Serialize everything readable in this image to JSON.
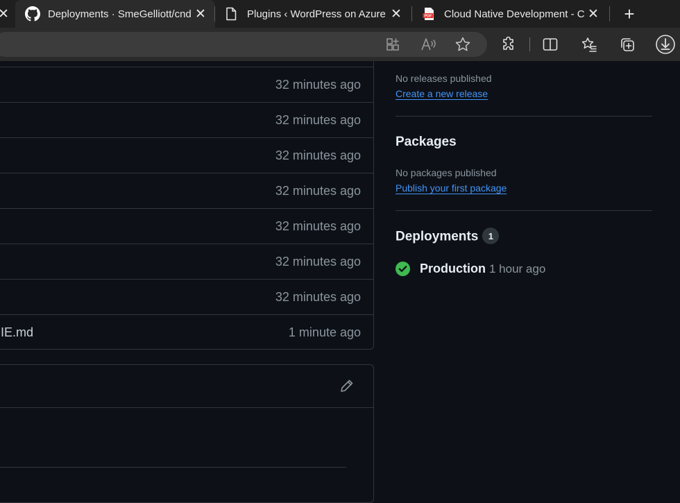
{
  "browser": {
    "tabs": [
      {
        "title": "Deployments · SmeGelliott/cnd",
        "icon": "github-icon"
      },
      {
        "title": "Plugins ‹ WordPress on Azure —",
        "icon": "page-icon"
      },
      {
        "title": "Cloud Native Development - C",
        "icon": "pdf-icon"
      }
    ],
    "new_tab_symbol": "+",
    "close_symbol": "✕"
  },
  "files": {
    "rows": [
      {
        "name": "",
        "time": "32 minutes ago"
      },
      {
        "name": "",
        "time": "32 minutes ago"
      },
      {
        "name": "",
        "time": "32 minutes ago"
      },
      {
        "name": "",
        "time": "32 minutes ago"
      },
      {
        "name": "",
        "time": "32 minutes ago"
      },
      {
        "name": "",
        "time": "32 minutes ago"
      },
      {
        "name": "",
        "time": "32 minutes ago"
      },
      {
        "name": "IE.md",
        "time": "1 minute ago"
      }
    ]
  },
  "sidebar": {
    "releases": {
      "empty_text": "No releases published",
      "link": "Create a new release"
    },
    "packages": {
      "heading": "Packages",
      "empty_text": "No packages published",
      "link": "Publish your first package"
    },
    "deployments": {
      "heading": "Deployments",
      "count": "1",
      "items": [
        {
          "name": "Production",
          "time": "1 hour ago",
          "status": "success"
        }
      ]
    }
  },
  "colors": {
    "background": "#0d1117",
    "border": "#30363d",
    "link": "#4493f8",
    "muted": "#8b949e",
    "success": "#3fb950"
  }
}
